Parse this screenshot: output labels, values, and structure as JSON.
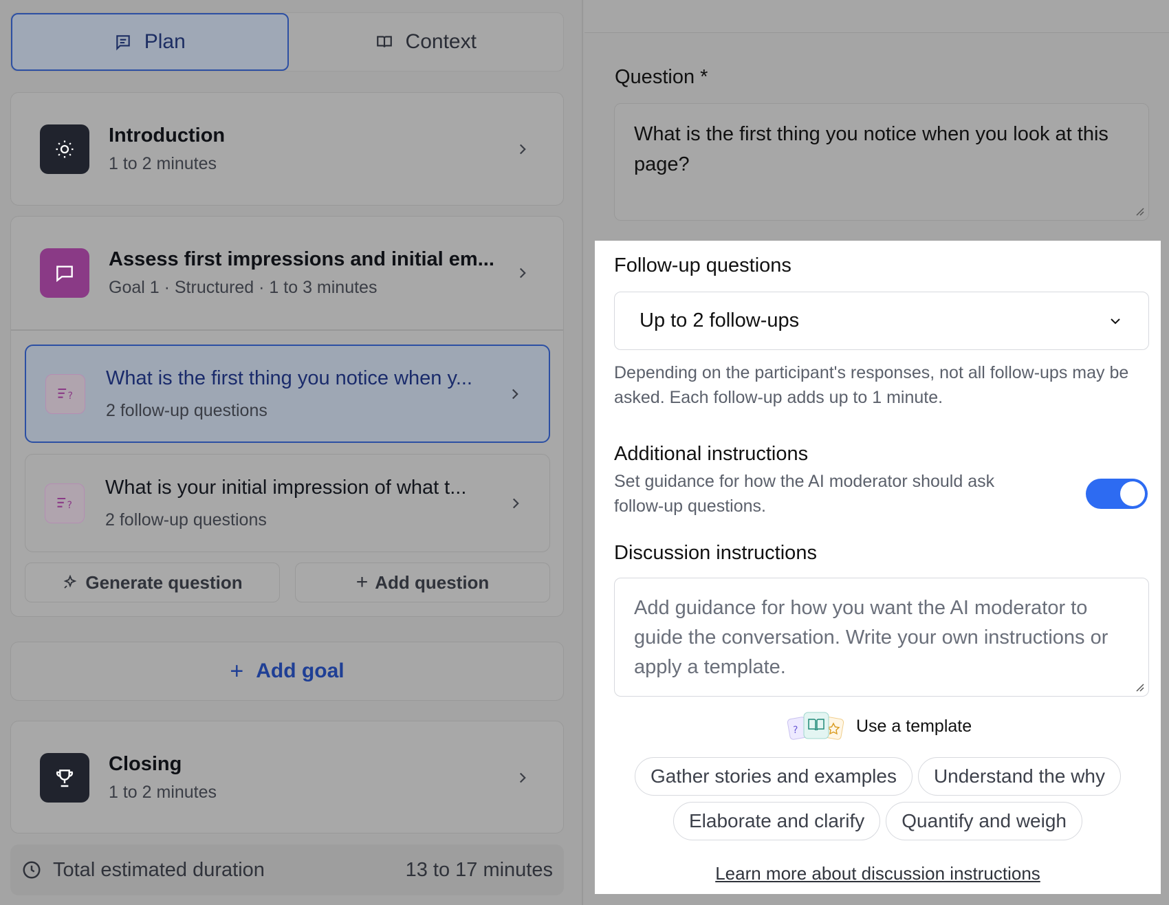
{
  "tabs": [
    {
      "label": "Plan",
      "icon": "list-icon",
      "active": true
    },
    {
      "label": "Context",
      "icon": "book-icon",
      "active": false
    }
  ],
  "introduction": {
    "title": "Introduction",
    "subtitle": "1 to 2 minutes"
  },
  "goal": {
    "title": "Assess first impressions and initial em...",
    "subtitle": "Goal 1 · Structured · 1 to 3 minutes"
  },
  "questions": [
    {
      "title": "What is the first thing you notice when y...",
      "subtitle": "2 follow-up questions",
      "selected": true
    },
    {
      "title": "What is your initial impression of what t...",
      "subtitle": "2 follow-up questions",
      "selected": false
    }
  ],
  "buttons": {
    "generate": "Generate question",
    "add_question": "Add question",
    "add_goal": "Add goal"
  },
  "closing": {
    "title": "Closing",
    "subtitle": "1 to 2 minutes"
  },
  "total": {
    "label": "Total estimated duration",
    "value": "13 to 17 minutes"
  },
  "editor": {
    "question_label": "Question *",
    "question_value": "What is the first thing you notice when you look at this page?",
    "followup_label": "Follow-up questions",
    "followup_value": "Up to 2 follow-ups",
    "followup_help": "Depending on the participant's responses, not all follow-ups may be asked. Each follow-up adds up to 1 minute.",
    "additional_label": "Additional instructions",
    "additional_help": "Set guidance for how the AI moderator should ask follow-up questions.",
    "additional_enabled": true,
    "discussion_label": "Discussion instructions",
    "discussion_placeholder": "Add guidance for how you want the AI moderator to guide the conversation. Write your own instructions or apply a template.",
    "template_label": "Use a template",
    "chips_row1": [
      "Gather stories and examples",
      "Understand the why"
    ],
    "chips_row2": [
      "Elaborate and clarify",
      "Quantify and weigh"
    ],
    "learn_more": "Learn more about discussion instructions"
  },
  "colors": {
    "accent": "#2d6bf2",
    "selected_border": "#2c4fa3",
    "goal_badge": "#8a3a86",
    "dark_badge": "#20232d"
  }
}
